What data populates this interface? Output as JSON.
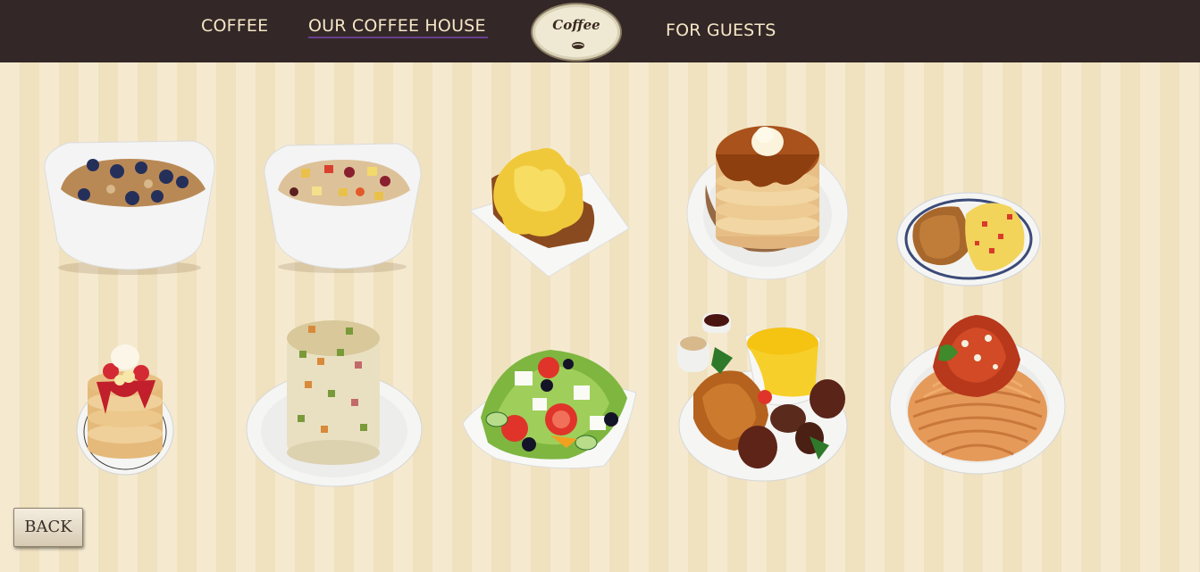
{
  "nav": {
    "coffee_label": "COFFEE",
    "house_label": "OUR COFFEE HOUSE",
    "guests_label": "FOR GUESTS"
  },
  "logo": {
    "text": "Coffee",
    "icon": "coffee-bean-icon"
  },
  "menu": {
    "row1": [
      {
        "name": "oatmeal-blueberry",
        "icon": "oatmeal-bowl"
      },
      {
        "name": "oatmeal-fruit",
        "icon": "oatmeal-bowl"
      },
      {
        "name": "scrambled-eggs-toast",
        "icon": "egg-toast-plate"
      },
      {
        "name": "pancake-stack",
        "icon": "pancake-plate"
      },
      {
        "name": "hashbrown-omelette",
        "icon": "breakfast-plate"
      }
    ],
    "row2": [
      {
        "name": "berry-pancakes",
        "icon": "pancake-plate"
      },
      {
        "name": "olivier-salad",
        "icon": "salad-tower-plate"
      },
      {
        "name": "greek-salad",
        "icon": "salad-plate"
      },
      {
        "name": "grilled-meat-rice",
        "icon": "meat-platter"
      },
      {
        "name": "spaghetti-bolognese",
        "icon": "pasta-plate"
      }
    ]
  },
  "back_label": "BACK",
  "colors": {
    "topbar": "#332727",
    "nav_text": "#f5e7c6",
    "background": "#f3e6c7",
    "link_underline": "#6a3f8f"
  }
}
